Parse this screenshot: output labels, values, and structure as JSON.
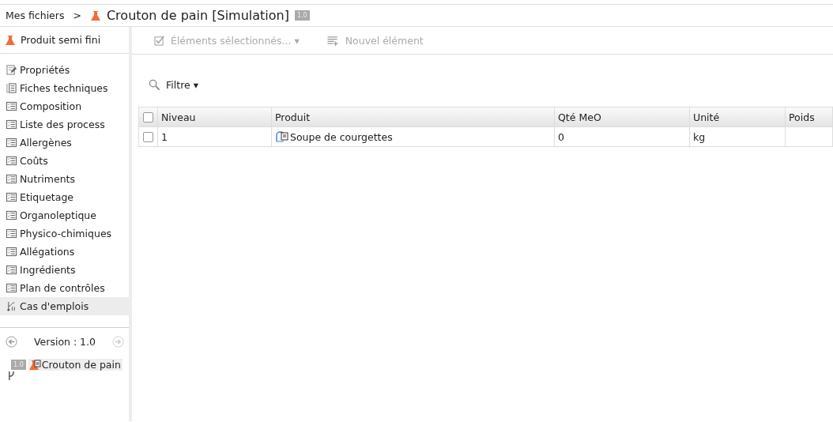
{
  "breadcrumb": {
    "root": "Mes fichiers",
    "separator": ">",
    "title": "Crouton de pain [Simulation]",
    "version_badge": "1.0"
  },
  "sidebar": {
    "header": "Produit semi fini",
    "items": [
      {
        "label": "Propriétés",
        "kind": "edit",
        "selected": false
      },
      {
        "label": "Fiches techniques",
        "kind": "documents",
        "selected": false
      },
      {
        "label": "Composition",
        "kind": "list",
        "selected": false
      },
      {
        "label": "Liste des process",
        "kind": "list",
        "selected": false
      },
      {
        "label": "Allergènes",
        "kind": "list",
        "selected": false
      },
      {
        "label": "Coûts",
        "kind": "list",
        "selected": false
      },
      {
        "label": "Nutriments",
        "kind": "list",
        "selected": false
      },
      {
        "label": "Etiquetage",
        "kind": "list",
        "selected": false
      },
      {
        "label": "Organoleptique",
        "kind": "list",
        "selected": false
      },
      {
        "label": "Physico-chimiques",
        "kind": "list",
        "selected": false
      },
      {
        "label": "Allégations",
        "kind": "list",
        "selected": false
      },
      {
        "label": "Ingrédients",
        "kind": "list",
        "selected": false
      },
      {
        "label": "Plan de contrôles",
        "kind": "list",
        "selected": false
      },
      {
        "label": "Cas d'emplois",
        "kind": "usage",
        "selected": true
      }
    ],
    "version": {
      "label": "Version : 1.0"
    },
    "version_tree": [
      {
        "badge": "1.0",
        "label": "Crouton de pain",
        "selected": true
      }
    ]
  },
  "toolbar": [
    {
      "label": "Éléments sélectionnés... ▾",
      "kind": "check",
      "disabled": true
    },
    {
      "label": "Nouvel élément",
      "kind": "add",
      "disabled": true
    }
  ],
  "filter": {
    "label": "Filtre ▾"
  },
  "table": {
    "all_checked": false,
    "columns": [
      "Niveau",
      "Produit",
      "Qté MeO",
      "Unité",
      "Poids"
    ],
    "rows": [
      {
        "checked": false,
        "cells": [
          "1",
          "Soupe de courgettes",
          "0",
          "kg",
          ""
        ]
      }
    ]
  }
}
